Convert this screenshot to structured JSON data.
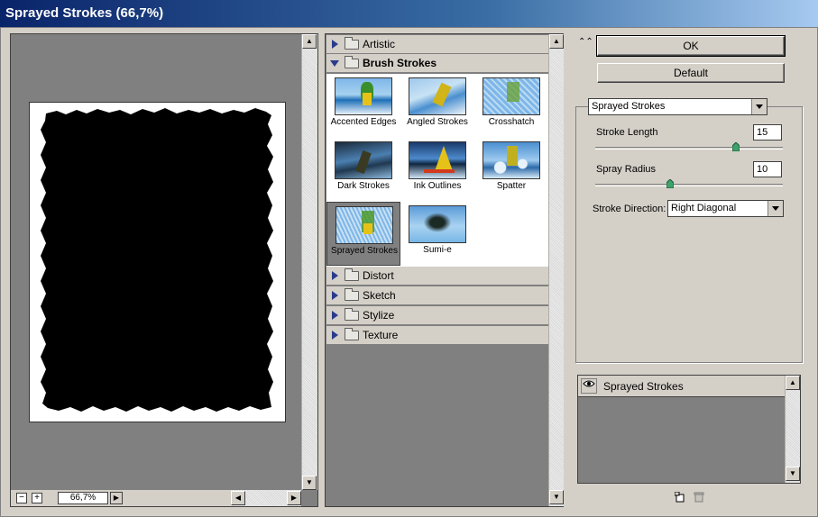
{
  "window": {
    "title": "Sprayed Strokes (66,7%)"
  },
  "preview": {
    "zoom": "66,7%",
    "zoom_out_icon": "minus-icon",
    "zoom_in_icon": "plus-icon"
  },
  "gallery": {
    "categories_top": [
      {
        "label": "Artistic",
        "expanded": false
      },
      {
        "label": "Brush Strokes",
        "expanded": true
      }
    ],
    "thumbnails": [
      {
        "label": "Accented Edges",
        "selected": false
      },
      {
        "label": "Angled Strokes",
        "selected": false
      },
      {
        "label": "Crosshatch",
        "selected": false
      },
      {
        "label": "Dark Strokes",
        "selected": false
      },
      {
        "label": "Ink Outlines",
        "selected": false
      },
      {
        "label": "Spatter",
        "selected": false
      },
      {
        "label": "Sprayed Strokes",
        "selected": true
      },
      {
        "label": "Sumi-e",
        "selected": false
      }
    ],
    "categories_bottom": [
      {
        "label": "Distort"
      },
      {
        "label": "Sketch"
      },
      {
        "label": "Stylize"
      },
      {
        "label": "Texture"
      }
    ]
  },
  "controls": {
    "ok_label": "OK",
    "default_label": "Default",
    "filter_select": "Sprayed Strokes",
    "stroke_length": {
      "label": "Stroke Length",
      "value": "15",
      "fraction": 0.75
    },
    "spray_radius": {
      "label": "Spray Radius",
      "value": "10",
      "fraction": 0.4
    },
    "stroke_direction": {
      "label": "Stroke Direction:",
      "value": "Right Diagonal"
    }
  },
  "layers": [
    {
      "name": "Sprayed Strokes",
      "visible": true
    }
  ],
  "colors": {
    "title_start": "#0a246a",
    "title_end": "#a6caf0",
    "panel": "#d4d0c8",
    "selected_thumb": "#808080"
  }
}
